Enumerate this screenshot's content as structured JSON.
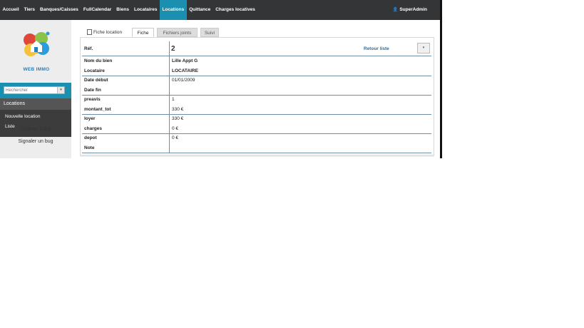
{
  "topbar": {
    "menu": [
      {
        "label": "Accueil"
      },
      {
        "label": "Tiers"
      },
      {
        "label": "Banques/Caisses"
      },
      {
        "label": "FullCalendar"
      },
      {
        "label": "Biens"
      },
      {
        "label": "Locataires"
      },
      {
        "label": "Locations"
      },
      {
        "label": "Quittance"
      },
      {
        "label": "Charges locatives"
      }
    ],
    "active_item": "Locations",
    "user": "SuperAdmin"
  },
  "sidebar": {
    "logo_text": "WEB IMMO",
    "search_placeholder": "Rechercher",
    "menu_title": "Locations",
    "items": [
      {
        "label": "Nouvelle location"
      },
      {
        "label": "Liste"
      }
    ],
    "version": "Dolibarr 3.9.0",
    "bug_link": "Signaler un bug"
  },
  "tabs": {
    "title": "Fiche location",
    "items": [
      {
        "label": "Fiche",
        "active": true
      },
      {
        "label": "Fichiers joints",
        "active": false
      },
      {
        "label": "Suivi",
        "active": false
      }
    ]
  },
  "card": {
    "ref_label": "Réf.",
    "ref_value": "2",
    "back_link": "Retour liste",
    "fields": [
      {
        "label": "Nom du bien",
        "value": "Lille Appt G"
      },
      {
        "label": "Locataire",
        "value": "LOCATAIRE"
      },
      {
        "label": "Date début",
        "value": "01/01/2009"
      },
      {
        "label": "Date fin",
        "value": ""
      },
      {
        "label": "preavis",
        "value": "1"
      },
      {
        "label": "montant_tot",
        "value": "330 €"
      },
      {
        "label": "loyer",
        "value": "330 €"
      },
      {
        "label": "charges",
        "value": "0 €"
      },
      {
        "label": "depot",
        "value": "0 €"
      },
      {
        "label": "Note",
        "value": ""
      }
    ]
  },
  "colors": {
    "topbar_bg": "#333537",
    "accent": "#1a8fb0",
    "link": "#2b6ea5"
  }
}
